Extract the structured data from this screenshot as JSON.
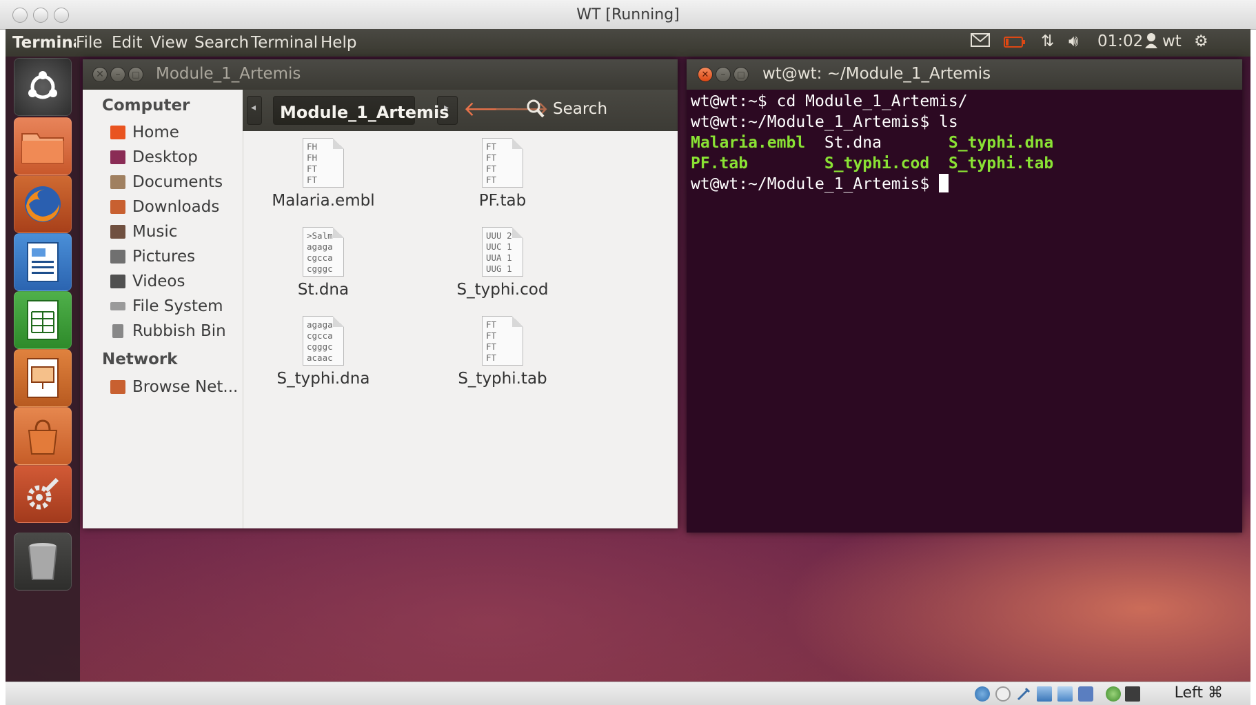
{
  "host_window": {
    "title": "WT [Running]"
  },
  "top_panel": {
    "app_name": "Terminal",
    "menus": [
      "File",
      "Edit",
      "View",
      "Search",
      "Terminal",
      "Help"
    ],
    "clock": "01:02",
    "user": "wt"
  },
  "file_manager": {
    "title": "Module_1_Artemis",
    "breadcrumb": "Module_1_Artemis",
    "search_label": "Search",
    "sidebar": {
      "computer_heading": "Computer",
      "computer_items": [
        {
          "label": "Home",
          "color": "#e95420"
        },
        {
          "label": "Desktop",
          "color": "#8a2c55"
        },
        {
          "label": "Documents",
          "color": "#a08060"
        },
        {
          "label": "Downloads",
          "color": "#c86030"
        },
        {
          "label": "Music",
          "color": "#705040"
        },
        {
          "label": "Pictures",
          "color": "#707070"
        },
        {
          "label": "Videos",
          "color": "#505050"
        },
        {
          "label": "File System",
          "color": "#9a9a9a"
        },
        {
          "label": "Rubbish Bin",
          "color": "#888888"
        }
      ],
      "network_heading": "Network",
      "network_items": [
        {
          "label": "Browse Net...",
          "color": "#c86030"
        }
      ]
    },
    "files": [
      {
        "name": "Malaria.embl",
        "preview": "FH\nFH\nFT\nFT"
      },
      {
        "name": "PF.tab",
        "preview": "FT\nFT\nFT\nFT"
      },
      {
        "name": "St.dna",
        "preview": ">Salm\nagaga\ncgcca\ncgggc"
      },
      {
        "name": "S_typhi.cod",
        "preview": "UUU 2\nUUC 1\nUUA 1\nUUG 1"
      },
      {
        "name": "S_typhi.dna",
        "preview": "agaga\ncgcca\ncgggc\nacaac"
      },
      {
        "name": "S_typhi.tab",
        "preview": "FT\nFT\nFT\nFT"
      }
    ]
  },
  "terminal": {
    "title": "wt@wt: ~/Module_1_Artemis",
    "line1": "wt@wt:~$ cd Module_1_Artemis/",
    "line2": "wt@wt:~/Module_1_Artemis$ ls",
    "ls_output": [
      "Malaria.embl",
      "St.dna",
      "S_typhi.dna",
      "PF.tab",
      "S_typhi.cod",
      "S_typhi.tab"
    ],
    "prompt": "wt@wt:~/Module_1_Artemis$ "
  },
  "statusbar": {
    "host_key": "Left ⌘"
  },
  "colors": {
    "ubuntu_orange": "#dd4814",
    "terminal_bg": "#2c0922",
    "ls_green": "#8ae234"
  }
}
